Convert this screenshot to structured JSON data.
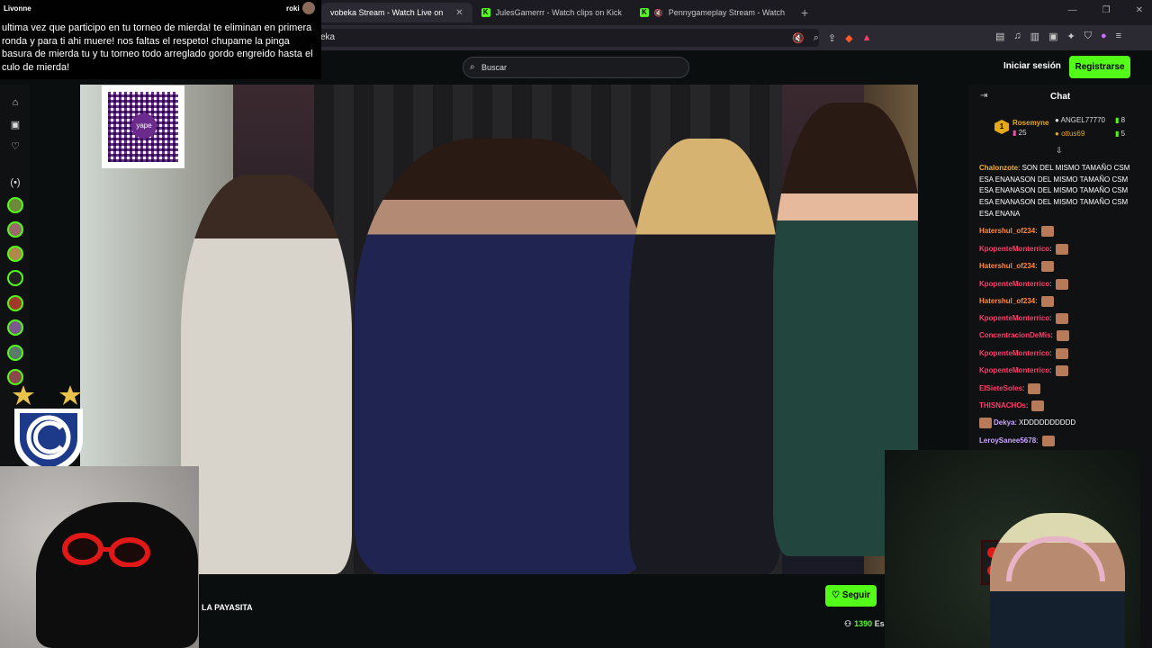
{
  "browser": {
    "tabs": [
      {
        "label": "vobeka Stream - Watch Live on",
        "active": true
      },
      {
        "label": "JulesGamerrr - Watch clips on Kick",
        "active": false
      },
      {
        "label": "Pennygameplay Stream - Watch",
        "active": false
      }
    ],
    "url": "eka"
  },
  "header": {
    "search_placeholder": "Buscar",
    "login_label": "Iniciar sesión",
    "register_label": "Registrarse"
  },
  "donation": {
    "user": "Livonne",
    "amount_label": "roki",
    "message": "ultima vez que participo en tu torneo de mierda! te eliminan en primera ronda y para ti ahi muere! nos faltas el respeto! chupame la pinga basura de mierda tu y tu torneo todo arreglado gordo engreido hasta el culo de mierda!"
  },
  "video": {
    "qr_label": "yape"
  },
  "channel": {
    "name_fragment": "LA PAYASITA",
    "follow_label": "Seguir",
    "viewers": "1390",
    "viewers_suffix": "Es"
  },
  "chat": {
    "title": "Chat",
    "leaderboard": [
      {
        "rank": "1",
        "name": "Rosemyne",
        "count": "25"
      },
      {
        "name": "ANGEL77770",
        "count": "8"
      },
      {
        "name": "ottus69",
        "count": "5"
      }
    ],
    "messages": [
      {
        "user": "Chalonzote",
        "color": "#f2b233",
        "text": "SON DEL MISMO TAMAÑO CSM ESA ENANASON DEL MISMO TAMAÑO CSM ESA ENANASON DEL MISMO TAMAÑO CSM ESA ENANASON DEL MISMO TAMAÑO CSM ESA ENANA"
      },
      {
        "user": "Hatershul_of234",
        "color": "#ff8a3d",
        "text": ""
      },
      {
        "user": "KpopenteMonterrico",
        "color": "#ff3d6b",
        "text": ""
      },
      {
        "user": "Hatershul_of234",
        "color": "#ff8a3d",
        "text": ""
      },
      {
        "user": "KpopenteMonterrico",
        "color": "#ff3d6b",
        "text": ""
      },
      {
        "user": "Hatershul_of234",
        "color": "#ff8a3d",
        "text": ""
      },
      {
        "user": "KpopenteMonterrico",
        "color": "#ff3d6b",
        "text": ""
      },
      {
        "user": "ConcentracionDeMis",
        "color": "#ff3d6b",
        "text": ""
      },
      {
        "user": "KpopenteMonterrico",
        "color": "#ff3d6b",
        "text": ""
      },
      {
        "user": "KpopenteMonterrico",
        "color": "#ff3d6b",
        "text": ""
      },
      {
        "user": "ElSieteSoles",
        "color": "#ff3d6b",
        "text": ""
      },
      {
        "user": "THISNACHOs",
        "color": "#ff3d6b",
        "text": ""
      },
      {
        "user": "Dekya",
        "color": "#c9a6ff",
        "text": "XDDDDDDDDDD"
      },
      {
        "user": "LeroySanee5678",
        "color": "#c9a6ff",
        "text": ""
      }
    ]
  },
  "colors": {
    "accent": "#53fc18",
    "background": "#0b0e0f"
  }
}
